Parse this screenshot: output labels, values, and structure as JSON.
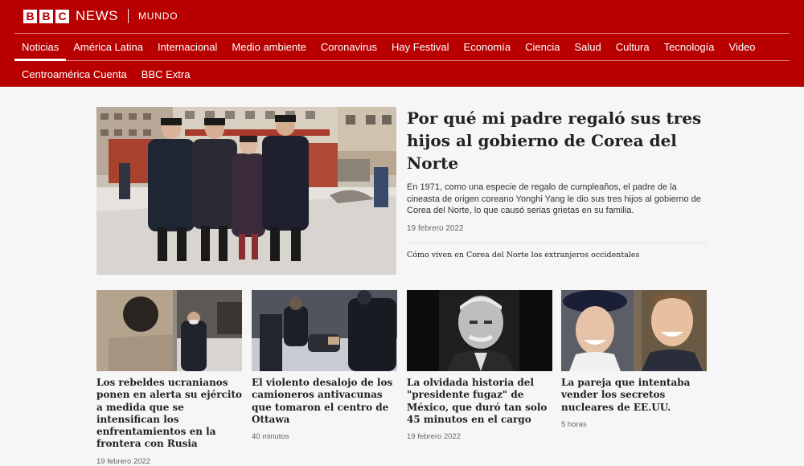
{
  "header": {
    "brand_letters": [
      "B",
      "B",
      "C"
    ],
    "brand_news": "NEWS",
    "service": "MUNDO",
    "nav_primary": [
      {
        "label": "Noticias",
        "active": true
      },
      {
        "label": "América Latina"
      },
      {
        "label": "Internacional"
      },
      {
        "label": "Medio ambiente"
      },
      {
        "label": "Coronavirus"
      },
      {
        "label": "Hay Festival"
      },
      {
        "label": "Economía"
      },
      {
        "label": "Ciencia"
      },
      {
        "label": "Salud"
      },
      {
        "label": "Cultura"
      },
      {
        "label": "Tecnología"
      },
      {
        "label": "Video"
      }
    ],
    "nav_secondary": [
      {
        "label": "Centroamérica Cuenta"
      },
      {
        "label": "BBC Extra"
      }
    ]
  },
  "top_story": {
    "title": "Por qué mi padre regaló sus tres hijos al gobierno de Corea del Norte",
    "summary": "En 1971, como una especie de regalo de cumpleaños, el padre de la cineasta de origen coreano Yonghi Yang le dio sus tres hijos al gobierno de Corea del Norte, lo que causó serias grietas en su familia.",
    "date": "19 febrero 2022",
    "related": "Cómo viven en Corea del Norte los extranjeros occidentales"
  },
  "stories": [
    {
      "title": "Los rebeldes ucranianos ponen en alerta su ejército a medida que se intensifican los enfrentamientos en la frontera con Rusia",
      "meta": "19 febrero 2022"
    },
    {
      "title": "El violento desalojo de los camioneros antivacunas que tomaron el centro de Ottawa",
      "meta": "40 minutos"
    },
    {
      "title": "La olvidada historia del \"presidente fugaz\" de México, que duró tan solo 45 minutos en el cargo",
      "meta": "19 febrero 2022"
    },
    {
      "title": "La pareja que intentaba vender los secretos nucleares de EE.UU.",
      "meta": "5 horas"
    }
  ],
  "colors": {
    "brand_red": "#b80000",
    "page_bg": "#f6f6f6"
  }
}
